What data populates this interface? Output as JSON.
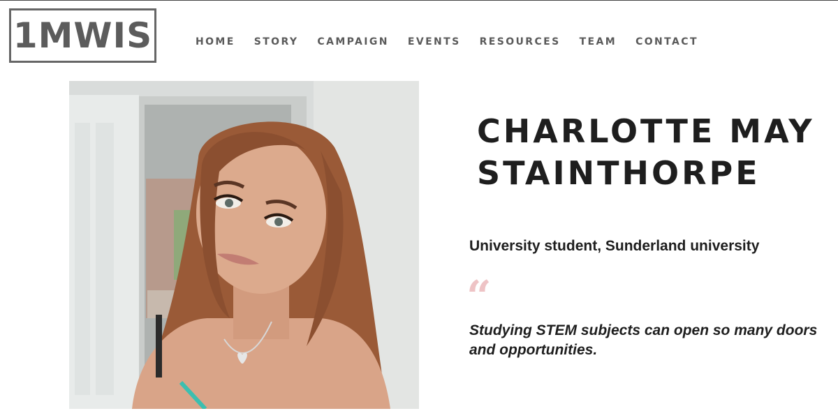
{
  "brand": {
    "logo_text": "1MWIS"
  },
  "nav": {
    "items": [
      {
        "label": "HOME"
      },
      {
        "label": "STORY"
      },
      {
        "label": "CAMPAIGN"
      },
      {
        "label": "EVENTS"
      },
      {
        "label": "RESOURCES"
      },
      {
        "label": "TEAM"
      },
      {
        "label": "CONTACT"
      }
    ]
  },
  "profile": {
    "name_line1": "CHARLOTTE MAY",
    "name_line2": "STAINTHORPE",
    "role": "University student, Sunderland university",
    "quote_mark": "“",
    "quote": "Studying STEM subjects can open so many doors and opportunities."
  },
  "colors": {
    "text": "#1e1e1e",
    "nav_text": "#5a5a5a",
    "logo": "#5c5c5c",
    "quote_mark": "#eec3c5"
  }
}
